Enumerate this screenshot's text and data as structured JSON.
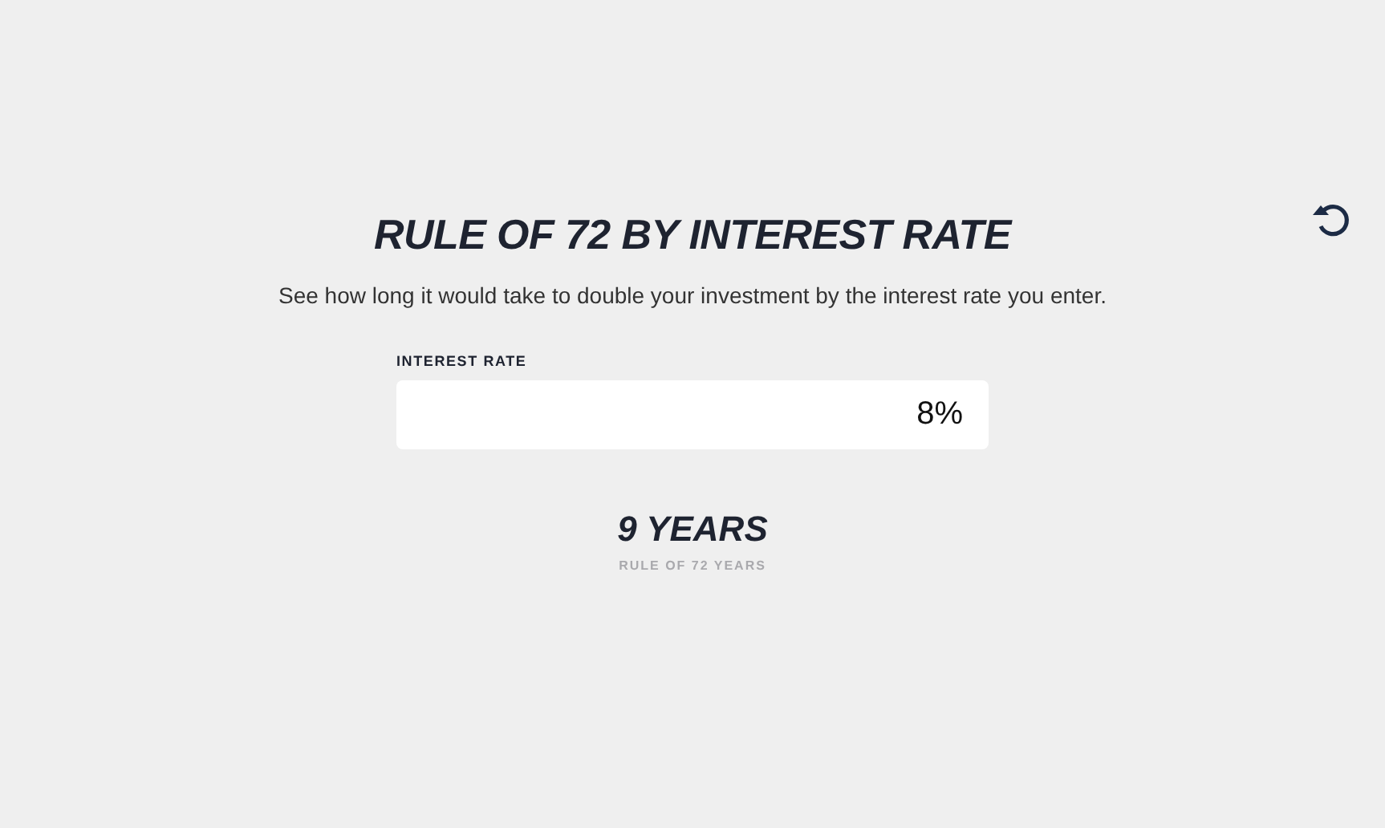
{
  "title": "RULE OF 72 BY INTEREST RATE",
  "description": "See how long it would take to double your investment by the interest rate you enter.",
  "interest_rate": {
    "label": "INTEREST RATE",
    "value": "8%"
  },
  "result": {
    "value": "9 YEARS",
    "caption": "RULE OF 72 YEARS"
  }
}
